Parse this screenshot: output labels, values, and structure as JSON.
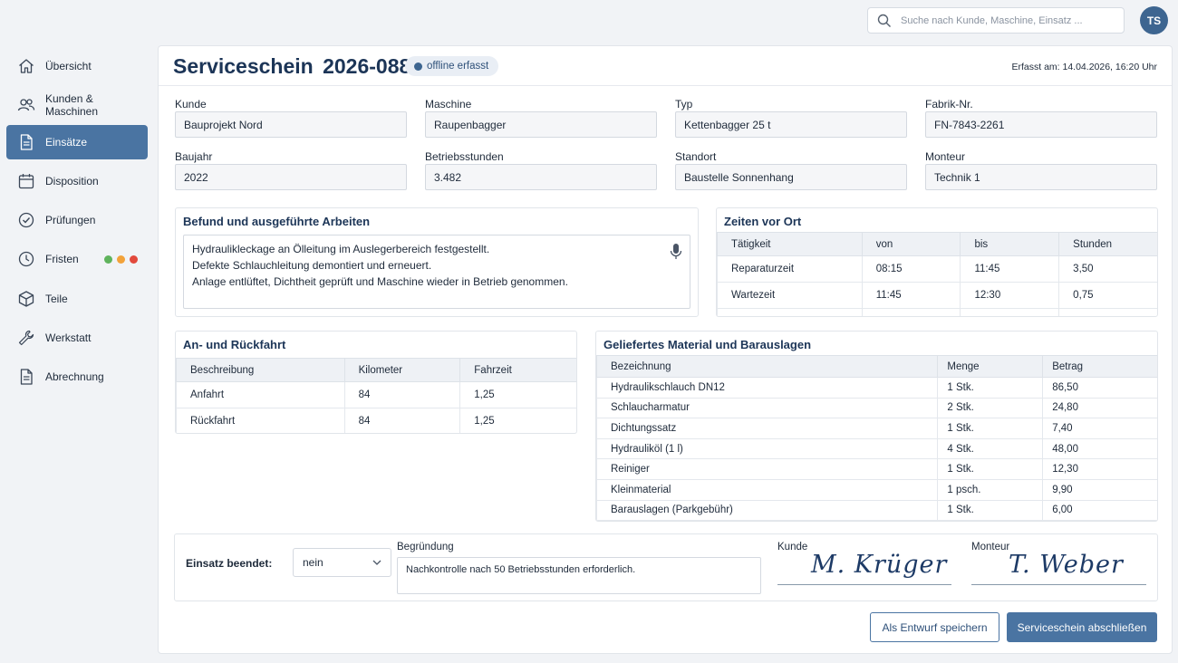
{
  "search": {
    "placeholder": "Suche nach Kunde, Maschine, Einsatz ..."
  },
  "user": {
    "initials": "TS"
  },
  "sidebar": {
    "items": [
      {
        "label": "Übersicht",
        "icon": "home-icon"
      },
      {
        "label": "Kunden & Maschinen",
        "icon": "users-icon"
      },
      {
        "label": "Einsätze",
        "icon": "document-icon",
        "active": true
      },
      {
        "label": "Disposition",
        "icon": "calendar-icon"
      },
      {
        "label": "Prüfungen",
        "icon": "check-circle-icon"
      },
      {
        "label": "Fristen",
        "icon": "clock-icon",
        "status_dots": [
          "#5fb35c",
          "#f2a23a",
          "#e2493c"
        ]
      },
      {
        "label": "Teile",
        "icon": "box-icon"
      },
      {
        "label": "Werkstatt",
        "icon": "wrench-icon"
      },
      {
        "label": "Abrechnung",
        "icon": "invoice-icon"
      }
    ]
  },
  "header": {
    "title": "Serviceschein  2026-0884",
    "badge": "offline erfasst",
    "erfasst": "Erfasst am: 14.04.2026, 16:20 Uhr"
  },
  "fields": {
    "kunde": {
      "label": "Kunde",
      "value": "Bauprojekt Nord"
    },
    "maschine": {
      "label": "Maschine",
      "value": "Raupenbagger"
    },
    "typ": {
      "label": "Typ",
      "value": "Kettenbagger 25 t"
    },
    "fabrik": {
      "label": "Fabrik-Nr.",
      "value": "FN-7843-2261"
    },
    "baujahr": {
      "label": "Baujahr",
      "value": "2022"
    },
    "betrieb": {
      "label": "Betriebsstunden",
      "value": "3.482"
    },
    "standort": {
      "label": "Standort",
      "value": "Baustelle Sonnenhang"
    },
    "monteur": {
      "label": "Monteur",
      "value": "Technik 1"
    }
  },
  "befund": {
    "title": "Befund und ausgeführte Arbeiten",
    "lines": [
      "Hydraulikleckage an Ölleitung im Auslegerbereich festgestellt.",
      "Defekte Schlauchleitung demontiert und erneuert.",
      "Anlage entlüftet, Dichtheit geprüft und Maschine wieder in Betrieb genommen."
    ]
  },
  "zeiten": {
    "title": "Zeiten vor Ort",
    "headers": [
      "Tätigkeit",
      "von",
      "bis",
      "Stunden"
    ],
    "rows": [
      [
        "Reparaturzeit",
        "08:15",
        "11:45",
        "3,50"
      ],
      [
        "Wartezeit",
        "11:45",
        "12:30",
        "0,75"
      ]
    ]
  },
  "fahrt": {
    "title": "An- und Rückfahrt",
    "headers": [
      "Beschreibung",
      "Kilometer",
      "Fahrzeit"
    ],
    "rows": [
      [
        "Anfahrt",
        "84",
        "1,25"
      ],
      [
        "Rückfahrt",
        "84",
        "1,25"
      ]
    ]
  },
  "material": {
    "title": "Geliefertes Material und Barauslagen",
    "headers": [
      "Bezeichnung",
      "Menge",
      "Betrag"
    ],
    "rows": [
      [
        "Hydraulikschlauch DN12",
        "1 Stk.",
        "86,50"
      ],
      [
        "Schlaucharmatur",
        "2 Stk.",
        "24,80"
      ],
      [
        "Dichtungssatz",
        "1 Stk.",
        "7,40"
      ],
      [
        "Hydrauliköl (1 l)",
        "4 Stk.",
        "48,00"
      ],
      [
        "Reiniger",
        "1 Stk.",
        "12,30"
      ],
      [
        "Kleinmaterial",
        "1 psch.",
        "9,90"
      ],
      [
        "Barauslagen (Parkgebühr)",
        "1 Stk.",
        "6,00"
      ]
    ]
  },
  "abschluss": {
    "beendet_label": "Einsatz beendet:",
    "beendet_value": "nein",
    "begruendung_label": "Begründung",
    "begruendung_value": "Nachkontrolle nach 50 Betriebsstunden erforderlich.",
    "kunde_label": "Kunde",
    "kunde_signature": "M. Krüger",
    "monteur_label": "Monteur",
    "monteur_signature": "T. Weber"
  },
  "actions": {
    "draft": "Als Entwurf speichern",
    "finish": "Serviceschein abschließen"
  }
}
